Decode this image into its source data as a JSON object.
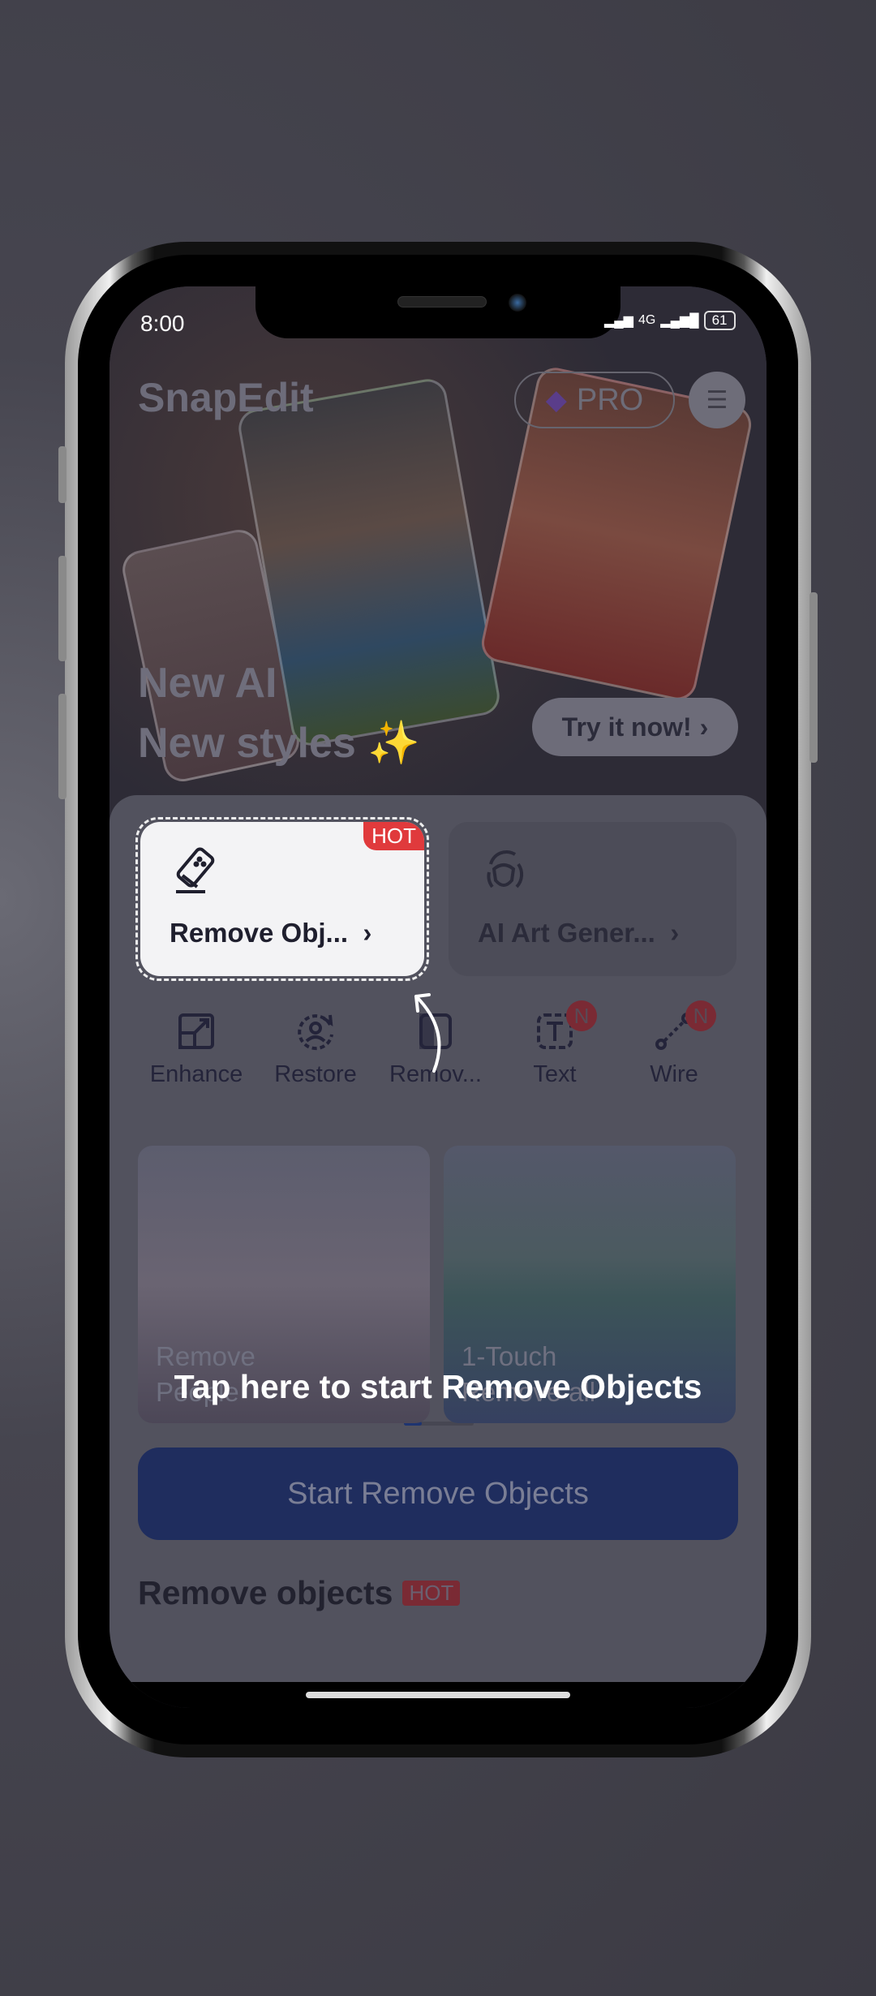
{
  "status_bar": {
    "time": "8:00",
    "network": "4G",
    "battery": "61"
  },
  "header": {
    "app_name": "SnapEdit",
    "pro_label": "PRO",
    "menu_icon": "hamburger-icon"
  },
  "banner": {
    "line1": "New AI",
    "line2": "New styles",
    "emoji": "✨",
    "cta": "Try it now!"
  },
  "feature_cards": [
    {
      "label": "Remove Obj...",
      "icon": "eraser-icon",
      "badge": "HOT"
    },
    {
      "label": "AI Art Gener...",
      "icon": "ai-face-icon"
    }
  ],
  "tools": [
    {
      "label": "Enhance",
      "icon": "enhance-icon"
    },
    {
      "label": "Restore",
      "icon": "restore-icon"
    },
    {
      "label": "Remov...",
      "icon": "remove-bg-icon"
    },
    {
      "label": "Text",
      "icon": "text-icon",
      "badge": "N"
    },
    {
      "label": "Wire",
      "icon": "wire-icon",
      "badge": "N"
    }
  ],
  "tooltip": "Tap here to start Remove Objects",
  "start_button": "Start Remove Objects",
  "section": {
    "title": "Remove objects",
    "badge": "HOT",
    "items": [
      {
        "line1": "Remove",
        "line2": "People"
      },
      {
        "line1": "1-Touch",
        "line2": "Remove all"
      }
    ]
  },
  "colors": {
    "accent": "#1f2d5e",
    "hot": "#e03a3c",
    "overlay": "#52525e"
  }
}
